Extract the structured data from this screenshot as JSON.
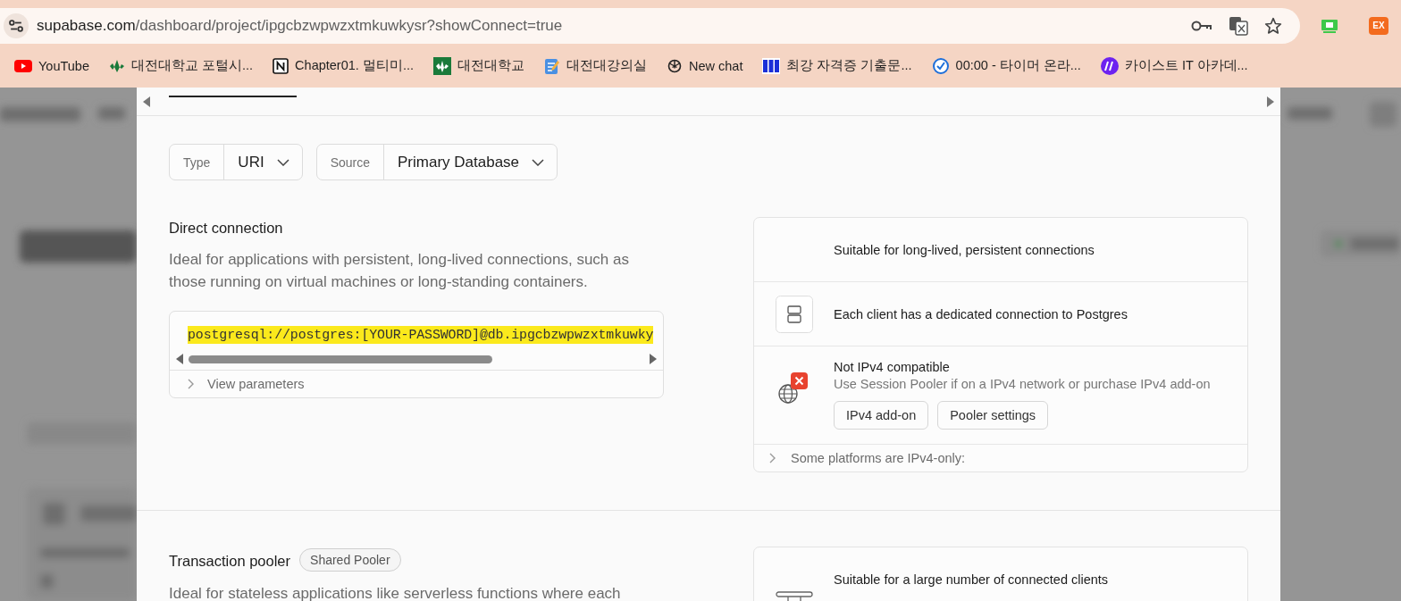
{
  "browser": {
    "url_host": "supabase.com",
    "url_path": "/dashboard/project/ipgcbzwpwzxtmkuwkysr?showConnect=true",
    "extension_badge": "EX",
    "bookmarks": [
      {
        "label": "YouTube"
      },
      {
        "label": "대전대학교 포털시..."
      },
      {
        "label": "Chapter01. 멀티미..."
      },
      {
        "label": "대전대학교"
      },
      {
        "label": "대전대강의실"
      },
      {
        "label": "New chat"
      },
      {
        "label": "최강 자격증 기출문..."
      },
      {
        "label": "00:00 - 타이머 온라..."
      },
      {
        "label": "카이스트 IT 아카데..."
      }
    ]
  },
  "modal": {
    "selectors": [
      {
        "label": "Type",
        "value": "URI"
      },
      {
        "label": "Source",
        "value": "Primary Database"
      }
    ],
    "direct": {
      "title": "Direct connection",
      "description": "Ideal for applications with persistent, long-lived connections, such as those running on virtual machines or long-standing containers.",
      "connection_string": "postgresql://postgres:[YOUR-PASSWORD]@db.ipgcbzwpwzxtmkuwky",
      "params_label": "View parameters",
      "features": [
        {
          "kind": "plain",
          "text": "Suitable for long-lived, persistent connections"
        },
        {
          "kind": "server",
          "text": "Each client has a dedicated connection to Postgres"
        },
        {
          "kind": "warning",
          "title": "Not IPv4 compatible",
          "text": "Use Session Pooler if on a IPv4 network or purchase IPv4 add-on",
          "buttons": [
            "IPv4 add-on",
            "Pooler settings"
          ]
        }
      ],
      "footer": "Some platforms are IPv4-only:"
    },
    "transaction": {
      "title": "Transaction pooler",
      "badge": "Shared Pooler",
      "description": "Ideal for stateless applications like serverless functions where each",
      "features": [
        {
          "kind": "pooler",
          "text": "Suitable for a large number of connected clients"
        }
      ]
    }
  }
}
